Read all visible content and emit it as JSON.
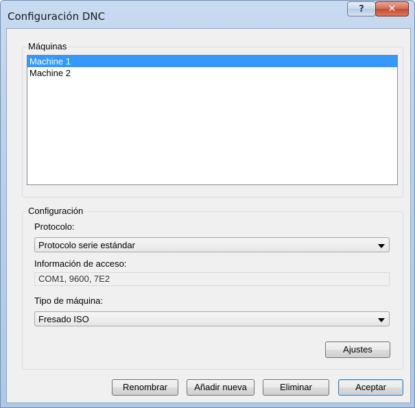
{
  "window": {
    "title": "Configuración DNC"
  },
  "titlebar": {
    "help_glyph": "?",
    "close_glyph": "✕",
    "help_icon": "help-icon",
    "close_icon": "close-icon"
  },
  "machines": {
    "legend": "Máquinas",
    "items": [
      {
        "label": "Machine 1",
        "selected": true
      },
      {
        "label": "Machine 2",
        "selected": false
      }
    ]
  },
  "config": {
    "legend": "Configuración",
    "protocol_label": "Protocolo:",
    "protocol_value": "Protocolo serie estándar",
    "access_label": "Información de acceso:",
    "access_value": "COM1, 9600, 7E2",
    "machine_type_label": "Tipo de máquina:",
    "machine_type_value": "Fresado ISO",
    "settings_button": "Ajustes"
  },
  "footer": {
    "rename_button": "Renombrar",
    "add_button": "Añadir nueva",
    "delete_button": "Eliminar",
    "accept_button": "Aceptar"
  },
  "colors": {
    "selection": "#3399ff",
    "titlebar": "#b9d0ea",
    "close": "#c44a34"
  }
}
